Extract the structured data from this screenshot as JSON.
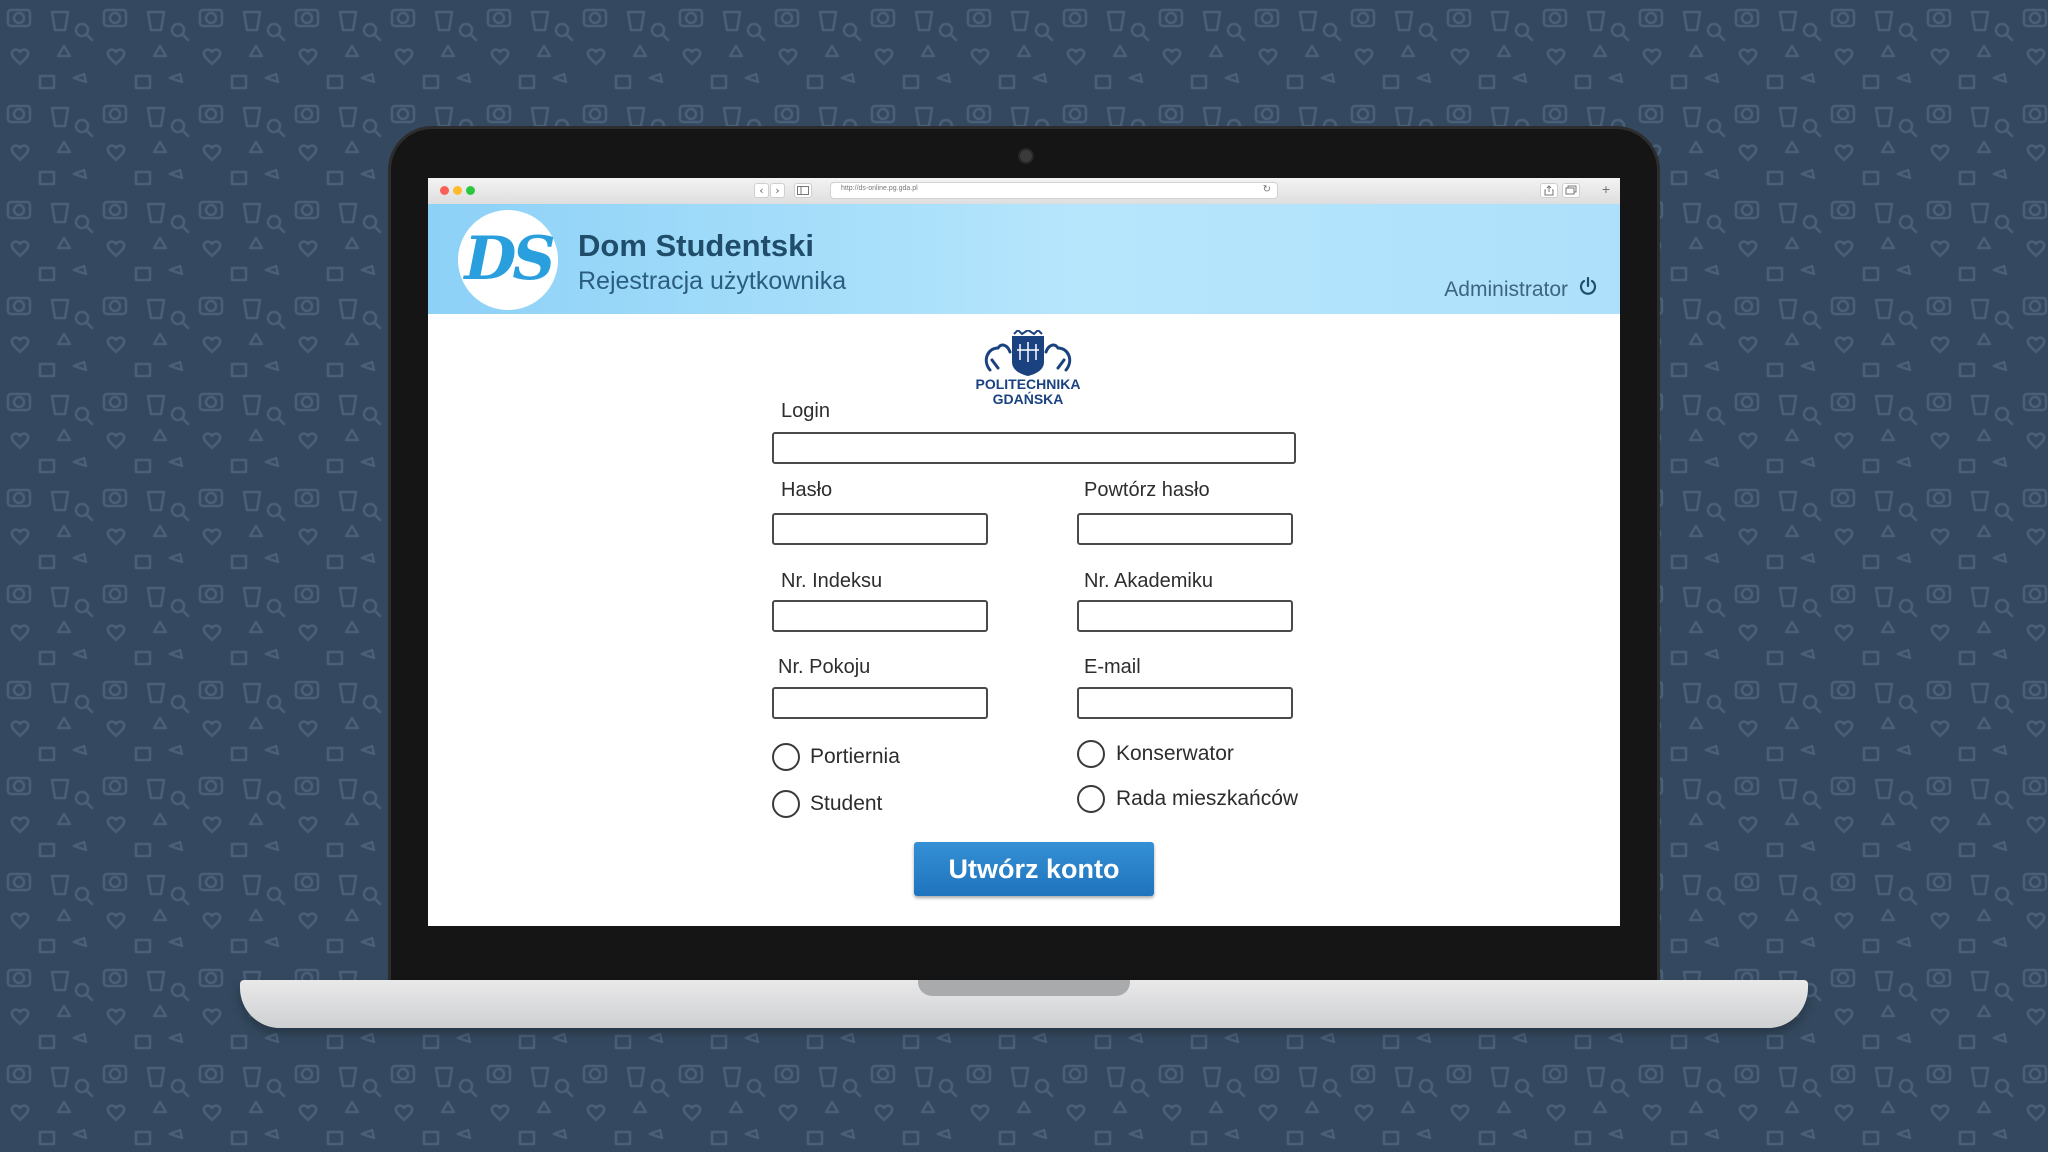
{
  "browser": {
    "url": "http://ds-online.pg.gda.pl"
  },
  "app": {
    "logo_text": "DS",
    "title": "Dom Studentski",
    "subtitle": "Rejestracja użytkownika",
    "user_label": "Administrator"
  },
  "university": {
    "name_line1": "POLITECHNIKA",
    "name_line2": "GDAŃSKA"
  },
  "form": {
    "login_label": "Login",
    "login_value": "",
    "password_label": "Hasło",
    "password_value": "",
    "repeat_password_label": "Powtórz hasło",
    "repeat_password_value": "",
    "index_label": "Nr. Indeksu",
    "index_value": "",
    "dorm_label": "Nr. Akademiku",
    "dorm_value": "",
    "room_label": "Nr. Pokoju",
    "room_value": "",
    "email_label": "E-mail",
    "email_value": "",
    "roles": [
      "Portiernia",
      "Konserwator",
      "Student",
      "Rada mieszkańców"
    ],
    "submit_label": "Utwórz konto"
  },
  "colors": {
    "background": "#34495f",
    "header_gradient_start": "#8dd1f7",
    "header_gradient_end": "#b6e6fc",
    "accent": "#2a9fde",
    "button": "#2680c8"
  },
  "icons": {
    "power": "power-icon",
    "back": "chevron-left-icon",
    "forward": "chevron-right-icon",
    "sidebar": "sidebar-icon",
    "reload": "reload-icon",
    "share": "share-icon",
    "tabs": "tabs-icon"
  }
}
